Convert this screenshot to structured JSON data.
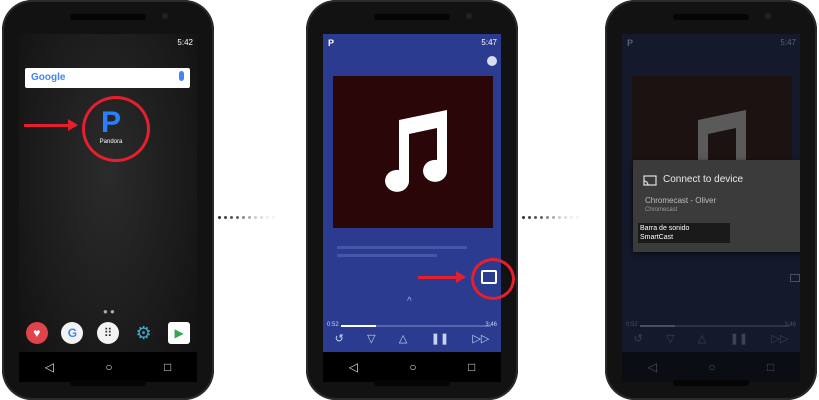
{
  "steps": [
    {
      "status_time": "5:42",
      "search_label": "Google",
      "app_label": "Pandora",
      "app_icon_letter": "P",
      "dock": [
        "pocket-icon",
        "google-icon",
        "apps-icon",
        "settings-icon",
        "play-store-icon"
      ]
    },
    {
      "status_time": "5:47",
      "status_left_icon": "P",
      "elapsed": "0:52",
      "remaining": "3:46",
      "controls": [
        "replay-icon",
        "thumbs-down-icon",
        "thumbs-up-icon",
        "pause-icon",
        "skip-icon"
      ]
    },
    {
      "status_time": "5:47",
      "status_left_icon": "P",
      "elapsed": "0:52",
      "remaining": "3:46",
      "dialog_title": "Connect to device",
      "device_name": "Chromecast - Oliver",
      "device_type": "Chromecast",
      "device_selected_line1": "Barra de sonido",
      "device_selected_line2": "SmartCast"
    }
  ],
  "colors": {
    "accent_red": "#e5202c",
    "pandora_blue": "#2a7fff",
    "player_blue": "#2b3b8f"
  }
}
